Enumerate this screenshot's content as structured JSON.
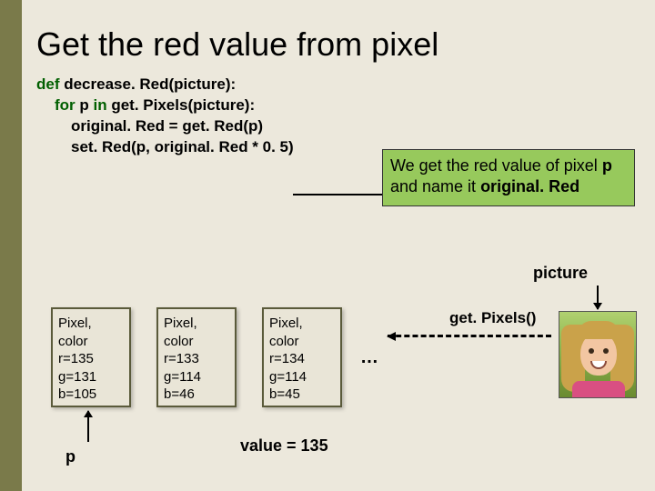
{
  "title": "Get the red value from pixel",
  "code": {
    "l1a": "def",
    "l1b": " decrease. Red(picture):",
    "l2a": "for",
    "l2b": " p ",
    "l2c": "in",
    "l2d": " get. Pixels(picture):",
    "l3": "original. Red = get. Red(p)",
    "l4": "set. Red(p, original. Red * 0. 5)"
  },
  "annotation": {
    "t1": "We get the red value of pixel ",
    "p": "p",
    "t2": " and name it ",
    "orig": "original. Red"
  },
  "picture_label": "picture",
  "getpixels_label": "get. Pixels()",
  "pixels": [
    {
      "l1": "Pixel,",
      "l2": "color",
      "l3": "r=135",
      "l4": "g=131",
      "l5": "b=105"
    },
    {
      "l1": "Pixel,",
      "l2": "color",
      "l3": "r=133",
      "l4": "g=114",
      "l5": "b=46"
    },
    {
      "l1": "Pixel,",
      "l2": "color",
      "l3": "r=134",
      "l4": "g=114",
      "l5": "b=45"
    }
  ],
  "ellipsis": "…",
  "p_label": "p",
  "value_label": "value = 135"
}
